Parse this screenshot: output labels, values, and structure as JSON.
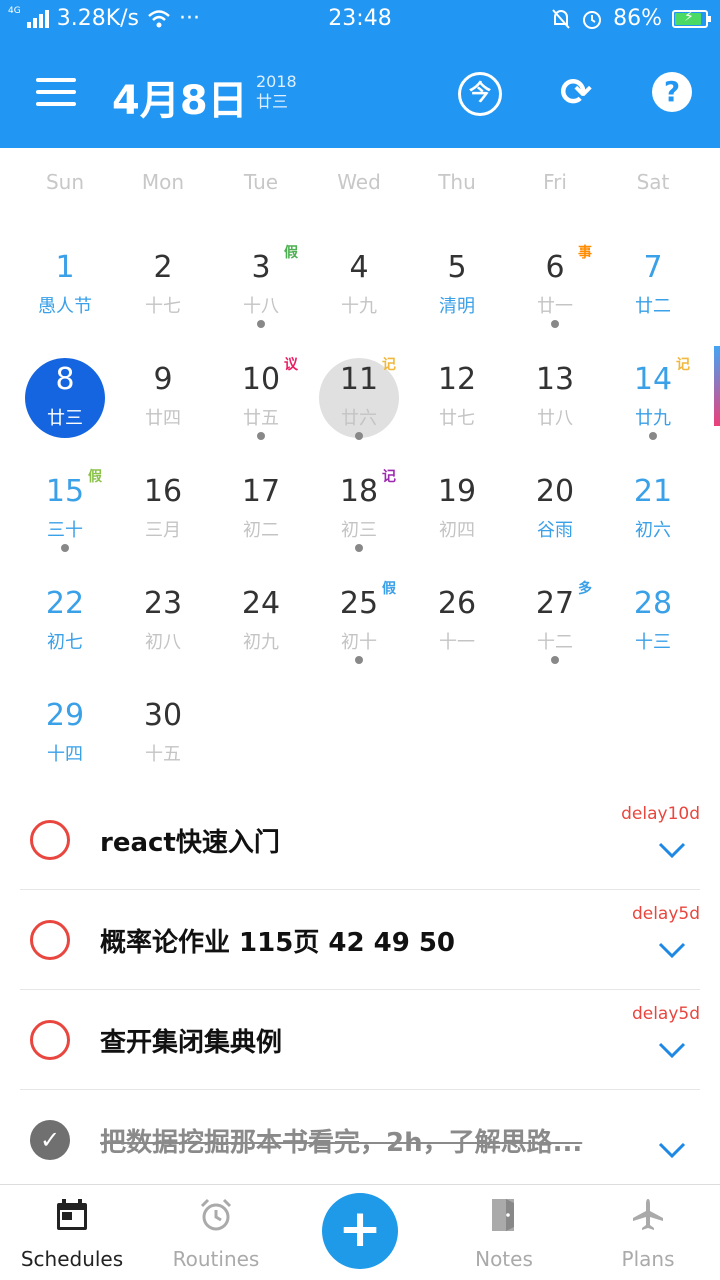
{
  "status_bar": {
    "network": "4G",
    "speed": "3.28K/s",
    "wifi": "wifi-icon",
    "more": "···",
    "time": "23:48",
    "battery_pct": "86%",
    "battery_level": 0.86
  },
  "app_bar": {
    "date": "4月8日",
    "year": "2018",
    "lunar": "廿三",
    "today_label": "今",
    "refresh_icon": "⟳",
    "help_label": "?"
  },
  "weekdays": [
    "Sun",
    "Mon",
    "Tue",
    "Wed",
    "Thu",
    "Fri",
    "Sat"
  ],
  "days": [
    {
      "num": "1",
      "lunar": "愚人节",
      "festival": true,
      "tag": "",
      "tag_color": "",
      "dot": false
    },
    {
      "num": "2",
      "lunar": "十七",
      "festival": false,
      "tag": "",
      "tag_color": "",
      "dot": false
    },
    {
      "num": "3",
      "lunar": "十八",
      "festival": false,
      "tag": "假",
      "tag_color": "#4CAF50",
      "dot": true
    },
    {
      "num": "4",
      "lunar": "十九",
      "festival": false,
      "tag": "",
      "tag_color": "",
      "dot": false
    },
    {
      "num": "5",
      "lunar": "清明",
      "festival": true,
      "tag": "",
      "tag_color": "",
      "dot": false
    },
    {
      "num": "6",
      "lunar": "廿一",
      "festival": false,
      "tag": "事",
      "tag_color": "#FF8C00",
      "dot": true
    },
    {
      "num": "7",
      "lunar": "廿二",
      "festival": false,
      "tag": "",
      "tag_color": "",
      "dot": false
    },
    {
      "num": "8",
      "lunar": "廿三",
      "festival": false,
      "tag": "",
      "tag_color": "",
      "dot": false,
      "selected": true
    },
    {
      "num": "9",
      "lunar": "廿四",
      "festival": false,
      "tag": "",
      "tag_color": "",
      "dot": false
    },
    {
      "num": "10",
      "lunar": "廿五",
      "festival": false,
      "tag": "议",
      "tag_color": "#E91E63",
      "dot": true
    },
    {
      "num": "11",
      "lunar": "廿六",
      "festival": false,
      "tag": "记",
      "tag_color": "#F0B840",
      "dot": true,
      "today": true
    },
    {
      "num": "12",
      "lunar": "廿七",
      "festival": false,
      "tag": "",
      "tag_color": "",
      "dot": false
    },
    {
      "num": "13",
      "lunar": "廿八",
      "festival": false,
      "tag": "",
      "tag_color": "",
      "dot": false
    },
    {
      "num": "14",
      "lunar": "廿九",
      "festival": false,
      "tag": "记",
      "tag_color": "#F0B840",
      "dot": true
    },
    {
      "num": "15",
      "lunar": "三十",
      "festival": false,
      "tag": "假",
      "tag_color": "#8BC34A",
      "dot": true
    },
    {
      "num": "16",
      "lunar": "三月",
      "festival": false,
      "tag": "",
      "tag_color": "",
      "dot": false
    },
    {
      "num": "17",
      "lunar": "初二",
      "festival": false,
      "tag": "",
      "tag_color": "",
      "dot": false
    },
    {
      "num": "18",
      "lunar": "初三",
      "festival": false,
      "tag": "记",
      "tag_color": "#9C27B0",
      "dot": true
    },
    {
      "num": "19",
      "lunar": "初四",
      "festival": false,
      "tag": "",
      "tag_color": "",
      "dot": false
    },
    {
      "num": "20",
      "lunar": "谷雨",
      "festival": true,
      "tag": "",
      "tag_color": "",
      "dot": false
    },
    {
      "num": "21",
      "lunar": "初六",
      "festival": false,
      "tag": "",
      "tag_color": "",
      "dot": false
    },
    {
      "num": "22",
      "lunar": "初七",
      "festival": false,
      "tag": "",
      "tag_color": "",
      "dot": false
    },
    {
      "num": "23",
      "lunar": "初八",
      "festival": false,
      "tag": "",
      "tag_color": "",
      "dot": false
    },
    {
      "num": "24",
      "lunar": "初九",
      "festival": false,
      "tag": "",
      "tag_color": "",
      "dot": false
    },
    {
      "num": "25",
      "lunar": "初十",
      "festival": false,
      "tag": "假",
      "tag_color": "#3AA0E8",
      "dot": true
    },
    {
      "num": "26",
      "lunar": "十一",
      "festival": false,
      "tag": "",
      "tag_color": "",
      "dot": false
    },
    {
      "num": "27",
      "lunar": "十二",
      "festival": false,
      "tag": "多",
      "tag_color": "#3AA0E8",
      "dot": true
    },
    {
      "num": "28",
      "lunar": "十三",
      "festival": false,
      "tag": "",
      "tag_color": "",
      "dot": false
    },
    {
      "num": "29",
      "lunar": "十四",
      "festival": false,
      "tag": "",
      "tag_color": "",
      "dot": false
    },
    {
      "num": "30",
      "lunar": "十五",
      "festival": false,
      "tag": "",
      "tag_color": "",
      "dot": false
    }
  ],
  "tasks": [
    {
      "title": "react快速入门",
      "delay": "delay10d",
      "done": false
    },
    {
      "title": "概率论作业 115页 42  49  50",
      "delay": "delay5d",
      "done": false
    },
    {
      "title": "查开集闭集典例",
      "delay": "delay5d",
      "done": false
    },
    {
      "title": "把数据挖掘那本书看完，2h，了解思路...",
      "delay": "",
      "done": true
    }
  ],
  "nav": {
    "schedules": "Schedules",
    "routines": "Routines",
    "add": "+",
    "notes": "Notes",
    "plans": "Plans"
  },
  "colors": {
    "primary": "#2196F3",
    "selected": "#1565E0",
    "weekend": "#3AA0E8",
    "task_ring": "#E8463E",
    "fab": "#1E9AE8"
  }
}
